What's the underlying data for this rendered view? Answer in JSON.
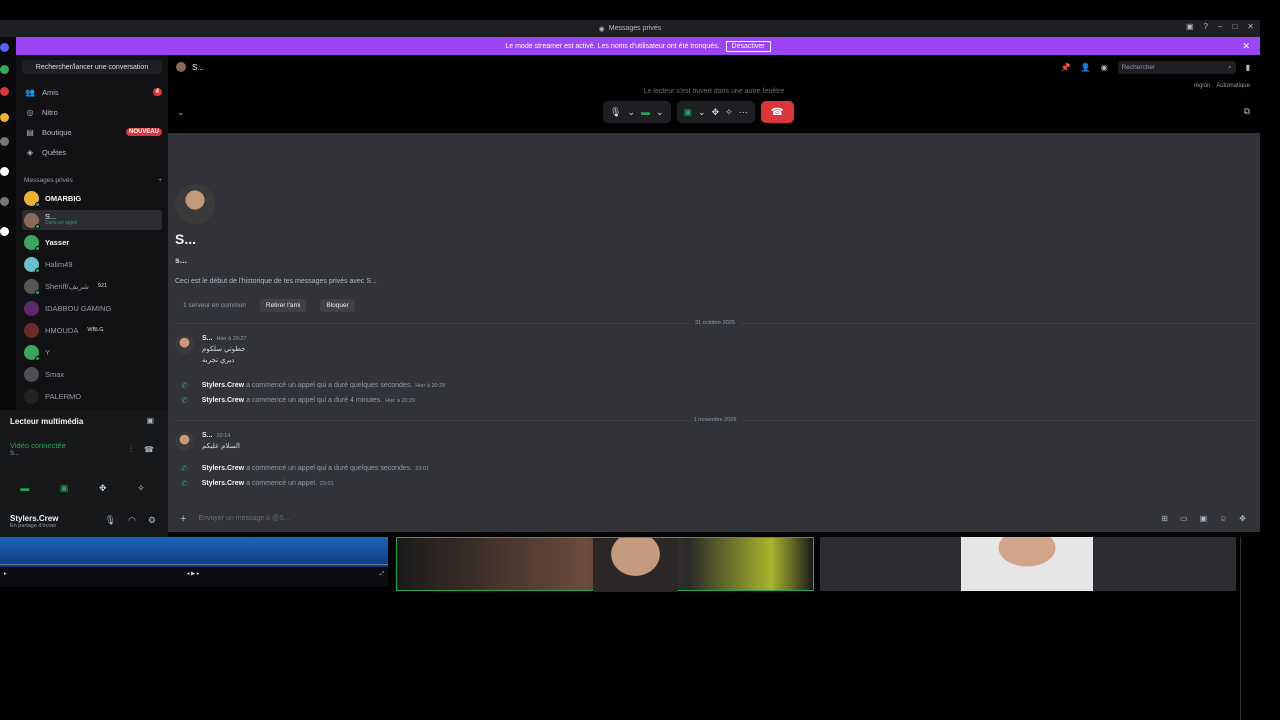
{
  "window": {
    "title": "Messages privés"
  },
  "banner": {
    "text": "Le mode streamer est activé. Les noms d'utilisateur ont été tronqués.",
    "button": "Désactiver"
  },
  "sidebar": {
    "search": "Rechercher/lancer une conversation",
    "nav": [
      {
        "label": "Amis",
        "badge": "4"
      },
      {
        "label": "Nitro"
      },
      {
        "label": "Boutique",
        "badge": "NOUVEAU"
      },
      {
        "label": "Quêtes"
      }
    ],
    "dm_header": "Messages privés",
    "dms": [
      {
        "name": "OMARBIG"
      },
      {
        "name": "S...",
        "sub": "Dans un appel"
      },
      {
        "name": "Yasser"
      },
      {
        "name": "Halim49"
      },
      {
        "name": "Sheriff/شريف",
        "tag": "921"
      },
      {
        "name": "IDABBOU GAMING"
      },
      {
        "name": "HMOUDA",
        "tag": "WBLG"
      },
      {
        "name": "Y"
      },
      {
        "name": "Smax"
      },
      {
        "name": "PALERMO"
      }
    ]
  },
  "media": {
    "title": "Lecteur multimédia",
    "status": "Vidéo connectée",
    "sub": "S..."
  },
  "user": {
    "name": "Stylers.Crew",
    "status": "En partage d'écran"
  },
  "call": {
    "user": "S...",
    "player_note": "Le lecteur s'est ouvert dans une autre fenêtre",
    "region_label": "région",
    "region_value": "Automatique",
    "search_placeholder": "Rechercher"
  },
  "chat": {
    "title": "S...",
    "handle": "s...",
    "intro": "Ceci est le début de l'historique de tes messages privés avec S...",
    "mutual": "1 serveur en commun",
    "remove_friend": "Retirer l'ami",
    "block": "Bloquer",
    "date1": "31 octobre 2025",
    "msg1": {
      "author": "S...",
      "time": "Hier à 20:27",
      "line1": "خطوتي سلكوم",
      "line2": "ديري تجربة"
    },
    "sys1": {
      "author": "Stylers.Crew",
      "text": "a commencé un appel qui a duré quelques secondes.",
      "time": "Hier à 20:29"
    },
    "sys2": {
      "author": "Stylers.Crew",
      "text": "a commencé un appel qui a duré 4 minutes.",
      "time": "Hier à 20:29"
    },
    "date2": "1 novembre 2025",
    "msg2": {
      "author": "S...",
      "time": "20:14",
      "line1": "السلام عليكم"
    },
    "sys3": {
      "author": "Stylers.Crew",
      "text": "a commencé un appel qui a duré quelques secondes.",
      "time": "23:01"
    },
    "sys4": {
      "author": "Stylers.Crew",
      "text": "a commencé un appel.",
      "time": "23:01"
    },
    "composer_placeholder": "Envoyer un message à @S..."
  },
  "colors": {
    "accent": "#9b45f5",
    "online": "#23a55a",
    "danger": "#da373c"
  }
}
